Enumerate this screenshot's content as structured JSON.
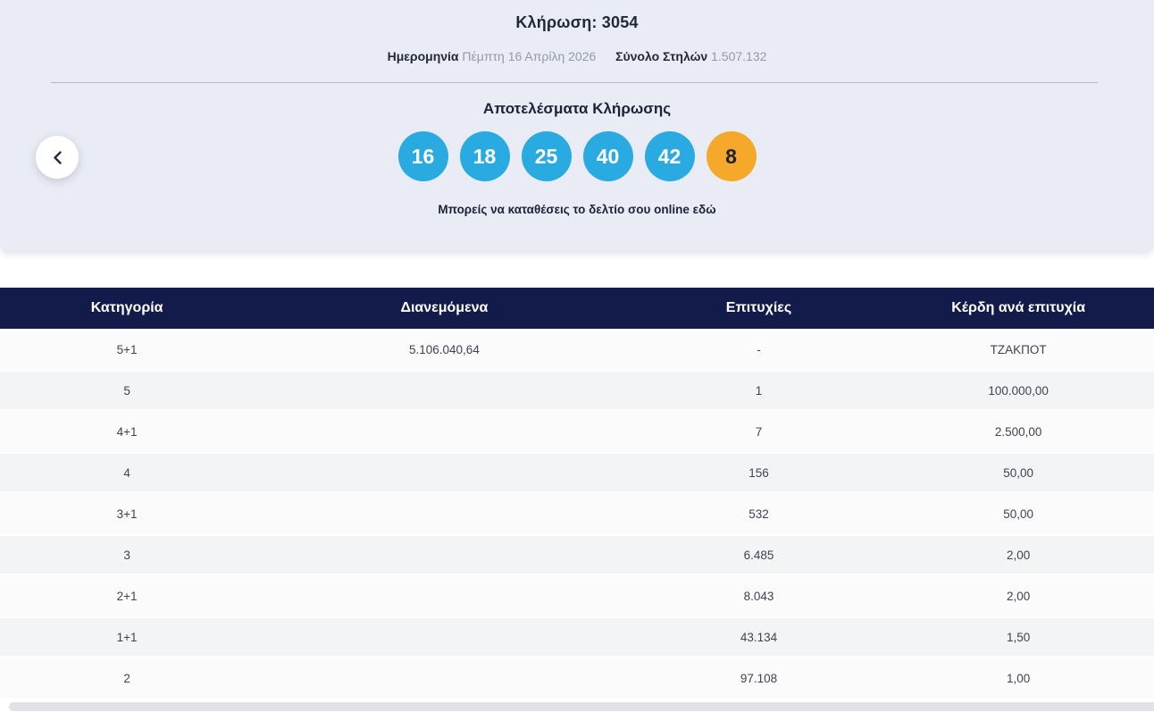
{
  "header": {
    "title_label": "Κλήρωση:",
    "draw_number": "3054",
    "date_label": "Ημερομηνία",
    "date_value": "Πέμπτη 16 Απρίλη 2026",
    "columns_label": "Σύνολο Στηλών",
    "columns_value": "1.507.132"
  },
  "results": {
    "heading": "Αποτελέσματα Κλήρωσης",
    "numbers": [
      "16",
      "18",
      "25",
      "40",
      "42"
    ],
    "joker": "8",
    "note": "Μπορείς να καταθέσεις το δελτίο σου online εδώ"
  },
  "colors": {
    "ball_blue": "#29abe2",
    "ball_orange": "#f6a82a",
    "table_header_bg": "#131b4a",
    "card_bg": "#e9ecf4",
    "navy_text": "#1d2238"
  },
  "table": {
    "headers": [
      "Κατηγορία",
      "Διανεμόμενα",
      "Επιτυχίες",
      "Κέρδη ανά επιτυχία"
    ],
    "rows": [
      {
        "category": "5+1",
        "distributed": "5.106.040,64",
        "winners": "-",
        "payout": "ΤΖΑΚΠΟΤ"
      },
      {
        "category": "5",
        "distributed": "",
        "winners": "1",
        "payout": "100.000,00"
      },
      {
        "category": "4+1",
        "distributed": "",
        "winners": "7",
        "payout": "2.500,00"
      },
      {
        "category": "4",
        "distributed": "",
        "winners": "156",
        "payout": "50,00"
      },
      {
        "category": "3+1",
        "distributed": "",
        "winners": "532",
        "payout": "50,00"
      },
      {
        "category": "3",
        "distributed": "",
        "winners": "6.485",
        "payout": "2,00"
      },
      {
        "category": "2+1",
        "distributed": "",
        "winners": "8.043",
        "payout": "2,00"
      },
      {
        "category": "1+1",
        "distributed": "",
        "winners": "43.134",
        "payout": "1,50"
      },
      {
        "category": "2",
        "distributed": "",
        "winners": "97.108",
        "payout": "1,00"
      }
    ]
  }
}
